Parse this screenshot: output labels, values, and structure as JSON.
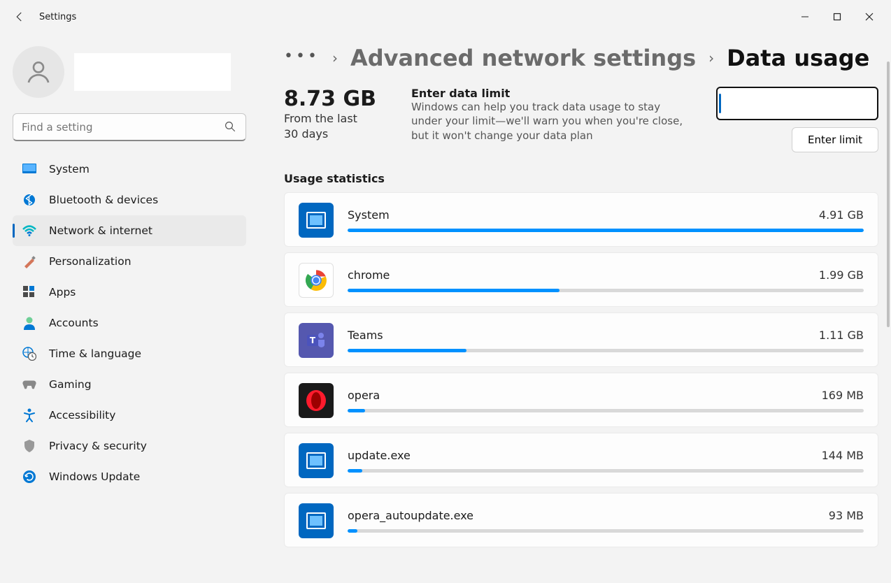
{
  "window": {
    "title": "Settings"
  },
  "search": {
    "placeholder": "Find a setting"
  },
  "sidebar": {
    "items": [
      {
        "label": "System"
      },
      {
        "label": "Bluetooth & devices"
      },
      {
        "label": "Network & internet"
      },
      {
        "label": "Personalization"
      },
      {
        "label": "Apps"
      },
      {
        "label": "Accounts"
      },
      {
        "label": "Time & language"
      },
      {
        "label": "Gaming"
      },
      {
        "label": "Accessibility"
      },
      {
        "label": "Privacy & security"
      },
      {
        "label": "Windows Update"
      }
    ],
    "active_index": 2
  },
  "breadcrumb": {
    "parent": "Advanced network settings",
    "current": "Data usage"
  },
  "summary": {
    "total": "8.73 GB",
    "period": "From the last 30 days",
    "limit_title": "Enter data limit",
    "limit_desc": "Windows can help you track data usage to stay under your limit—we'll warn you when you're close, but it won't change your data plan",
    "enter_limit_btn": "Enter limit"
  },
  "section_title": "Usage statistics",
  "usage": [
    {
      "name": "System",
      "amount": "4.91 GB",
      "bar_pct": 100,
      "icon": "system"
    },
    {
      "name": "chrome",
      "amount": "1.99 GB",
      "bar_pct": 41,
      "icon": "chrome"
    },
    {
      "name": "Teams",
      "amount": "1.11 GB",
      "bar_pct": 23,
      "icon": "teams"
    },
    {
      "name": "opera",
      "amount": "169 MB",
      "bar_pct": 3.4,
      "icon": "opera"
    },
    {
      "name": "update.exe",
      "amount": "144 MB",
      "bar_pct": 2.9,
      "icon": "system"
    },
    {
      "name": "opera_autoupdate.exe",
      "amount": "93 MB",
      "bar_pct": 1.9,
      "icon": "system"
    }
  ]
}
